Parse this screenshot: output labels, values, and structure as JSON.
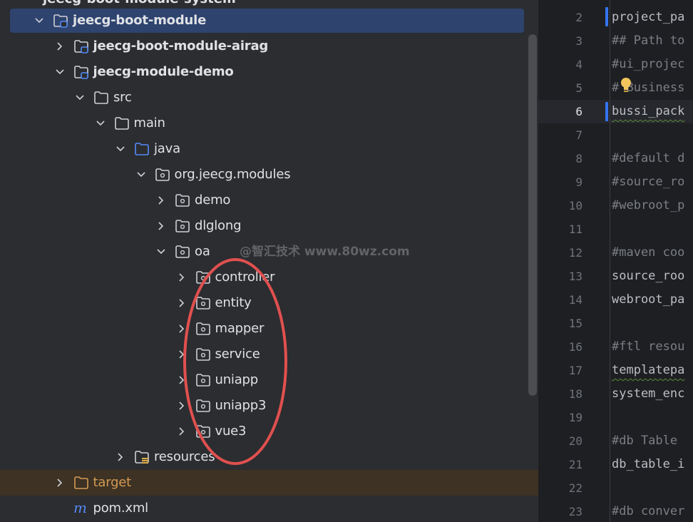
{
  "project_tree": {
    "top_partial_label": "jeecg-boot-module-system",
    "items": [
      {
        "label": "jeecg-boot-module",
        "icon": "module-folder-icon",
        "chevron": "down",
        "bold": true,
        "selected": true
      },
      {
        "label": "jeecg-boot-module-airag",
        "icon": "module-folder-icon",
        "chevron": "right",
        "bold": true
      },
      {
        "label": "jeecg-module-demo",
        "icon": "module-folder-icon",
        "chevron": "down",
        "bold": true
      },
      {
        "label": "src",
        "icon": "folder-icon",
        "chevron": "down"
      },
      {
        "label": "main",
        "icon": "folder-icon",
        "chevron": "down"
      },
      {
        "label": "java",
        "icon": "source-folder-icon",
        "chevron": "down"
      },
      {
        "label": "org.jeecg.modules",
        "icon": "package-icon",
        "chevron": "down"
      },
      {
        "label": "demo",
        "icon": "package-icon",
        "chevron": "right"
      },
      {
        "label": "dlglong",
        "icon": "package-icon",
        "chevron": "right"
      },
      {
        "label": "oa",
        "icon": "package-icon",
        "chevron": "down"
      },
      {
        "label": "controller",
        "icon": "package-icon",
        "chevron": "right"
      },
      {
        "label": "entity",
        "icon": "package-icon",
        "chevron": "right"
      },
      {
        "label": "mapper",
        "icon": "package-icon",
        "chevron": "right"
      },
      {
        "label": "service",
        "icon": "package-icon",
        "chevron": "right"
      },
      {
        "label": "uniapp",
        "icon": "package-icon",
        "chevron": "right"
      },
      {
        "label": "uniapp3",
        "icon": "package-icon",
        "chevron": "right"
      },
      {
        "label": "vue3",
        "icon": "package-icon",
        "chevron": "right"
      },
      {
        "label": "resources",
        "icon": "resources-folder-icon",
        "chevron": "right"
      },
      {
        "label": "target",
        "icon": "excluded-folder-icon",
        "chevron": "right",
        "excluded": true
      },
      {
        "label": "pom.xml",
        "icon": "maven-icon",
        "chevron": "none"
      }
    ]
  },
  "watermark": "@智汇技术 www.80wz.com",
  "editor": {
    "current_line": "6",
    "lines": [
      {
        "num": "2",
        "text": "project_pa",
        "style": "code"
      },
      {
        "num": "3",
        "text": "## Path to",
        "style": "comment"
      },
      {
        "num": "4",
        "text": "#ui_projec",
        "style": "comment"
      },
      {
        "num": "5",
        "text": "# Business",
        "style": "comment"
      },
      {
        "num": "6",
        "text": "bussi_pack",
        "style": "warn"
      },
      {
        "num": "7",
        "text": "",
        "style": "code"
      },
      {
        "num": "8",
        "text": "#default d",
        "style": "comment"
      },
      {
        "num": "9",
        "text": "#source_ro",
        "style": "comment"
      },
      {
        "num": "10",
        "text": "#webroot_p",
        "style": "comment"
      },
      {
        "num": "11",
        "text": "",
        "style": "code"
      },
      {
        "num": "12",
        "text": "#maven coo",
        "style": "comment"
      },
      {
        "num": "13",
        "text": "source_roo",
        "style": "code"
      },
      {
        "num": "14",
        "text": "webroot_pa",
        "style": "code"
      },
      {
        "num": "15",
        "text": "",
        "style": "code"
      },
      {
        "num": "16",
        "text": "#ftl resou",
        "style": "comment"
      },
      {
        "num": "17",
        "text": "templatepa",
        "style": "warn"
      },
      {
        "num": "18",
        "text": "system_enc",
        "style": "code"
      },
      {
        "num": "19",
        "text": "",
        "style": "code"
      },
      {
        "num": "20",
        "text": "#db Table",
        "style": "comment"
      },
      {
        "num": "21",
        "text": "db_table_i",
        "style": "code"
      },
      {
        "num": "22",
        "text": "",
        "style": "code"
      },
      {
        "num": "23",
        "text": "#db conver",
        "style": "comment"
      }
    ]
  },
  "colors": {
    "selection": "#2e436e",
    "annotation_ellipse": "#e0504f",
    "excluded_row": "#3d3223",
    "target_label": "#d39a55"
  }
}
